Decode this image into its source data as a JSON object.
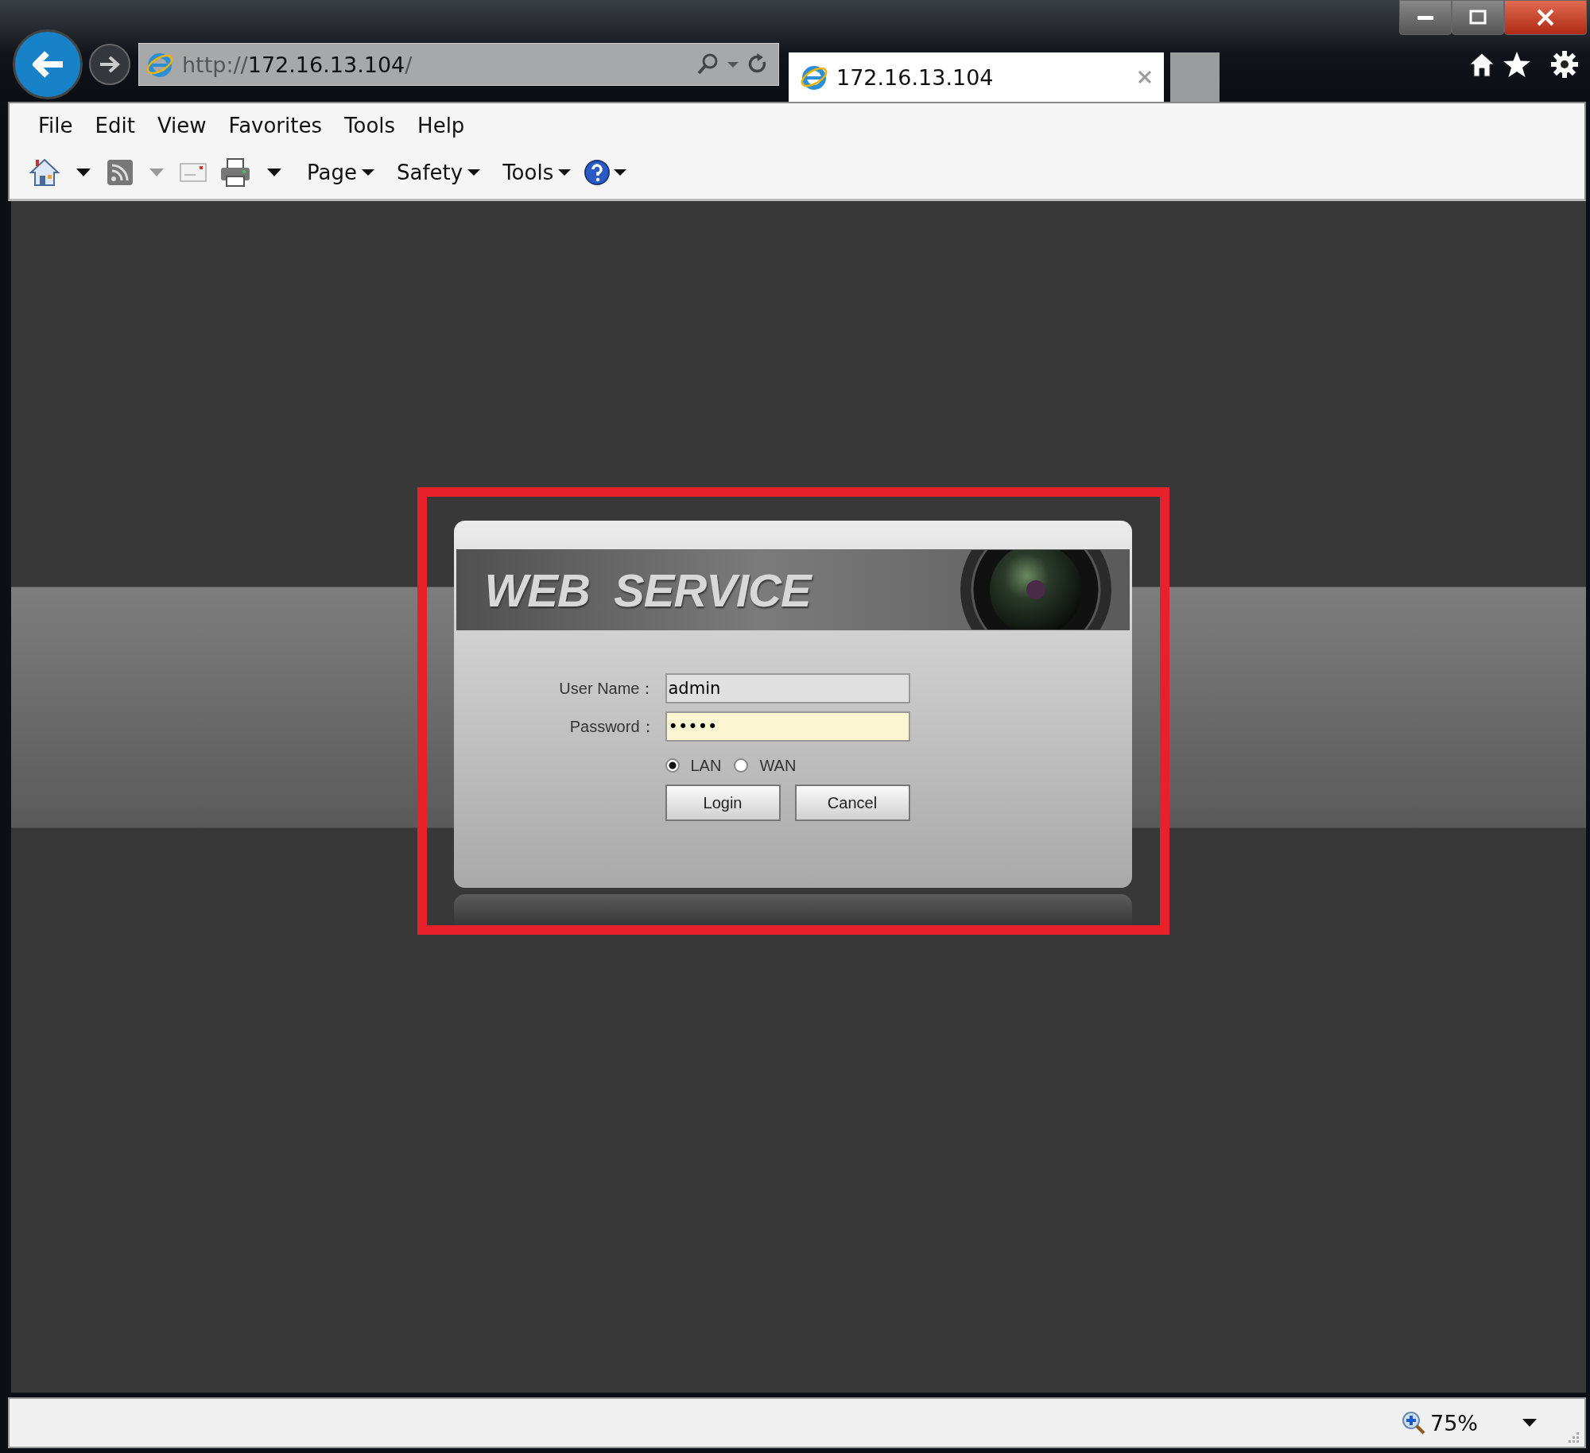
{
  "address_bar": {
    "scheme": "http://",
    "host": "172.16.13.104",
    "suffix": "/"
  },
  "tab": {
    "title": "172.16.13.104",
    "selected": true
  },
  "menu": [
    "File",
    "Edit",
    "View",
    "Favorites",
    "Tools",
    "Help"
  ],
  "toolbar": [
    {
      "kind": "home"
    },
    {
      "kind": "caret"
    },
    {
      "kind": "feed"
    },
    {
      "kind": "caret_dim"
    },
    {
      "kind": "mail"
    },
    {
      "kind": "print"
    },
    {
      "kind": "caret"
    },
    {
      "kind": "menu",
      "label": "Page"
    },
    {
      "kind": "menu",
      "label": "Safety"
    },
    {
      "kind": "menu",
      "label": "Tools"
    },
    {
      "kind": "help"
    }
  ],
  "login": {
    "title": "WEB  SERVICE",
    "fields": [
      {
        "label": "User Name：",
        "value": "admin",
        "autofilled": false
      },
      {
        "label": "Password：",
        "value": "•••••",
        "autofilled": true
      }
    ],
    "network": [
      {
        "label": "LAN",
        "selected": true
      },
      {
        "label": "WAN",
        "selected": false
      }
    ],
    "buttons": [
      "Login",
      "Cancel"
    ]
  },
  "status_bar": {
    "zoom": "75%"
  }
}
